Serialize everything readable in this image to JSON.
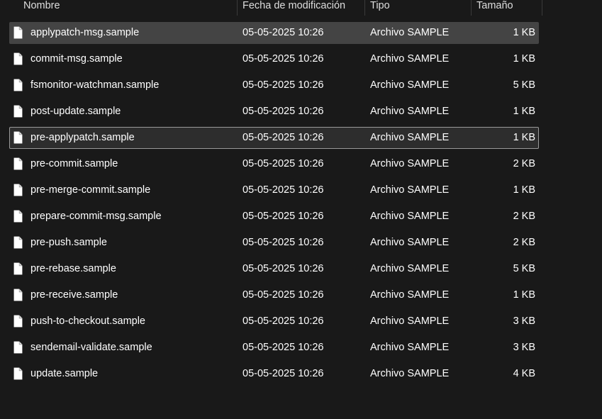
{
  "columns": {
    "name": "Nombre",
    "date": "Fecha de modificación",
    "type": "Tipo",
    "size": "Tamaño"
  },
  "files": [
    {
      "name": "applypatch-msg.sample",
      "date": "05-05-2025 10:26",
      "type": "Archivo SAMPLE",
      "size": "1 KB",
      "state": "selected"
    },
    {
      "name": "commit-msg.sample",
      "date": "05-05-2025 10:26",
      "type": "Archivo SAMPLE",
      "size": "1 KB",
      "state": ""
    },
    {
      "name": "fsmonitor-watchman.sample",
      "date": "05-05-2025 10:26",
      "type": "Archivo SAMPLE",
      "size": "5 KB",
      "state": ""
    },
    {
      "name": "post-update.sample",
      "date": "05-05-2025 10:26",
      "type": "Archivo SAMPLE",
      "size": "1 KB",
      "state": ""
    },
    {
      "name": "pre-applypatch.sample",
      "date": "05-05-2025 10:26",
      "type": "Archivo SAMPLE",
      "size": "1 KB",
      "state": "focused"
    },
    {
      "name": "pre-commit.sample",
      "date": "05-05-2025 10:26",
      "type": "Archivo SAMPLE",
      "size": "2 KB",
      "state": ""
    },
    {
      "name": "pre-merge-commit.sample",
      "date": "05-05-2025 10:26",
      "type": "Archivo SAMPLE",
      "size": "1 KB",
      "state": ""
    },
    {
      "name": "prepare-commit-msg.sample",
      "date": "05-05-2025 10:26",
      "type": "Archivo SAMPLE",
      "size": "2 KB",
      "state": ""
    },
    {
      "name": "pre-push.sample",
      "date": "05-05-2025 10:26",
      "type": "Archivo SAMPLE",
      "size": "2 KB",
      "state": ""
    },
    {
      "name": "pre-rebase.sample",
      "date": "05-05-2025 10:26",
      "type": "Archivo SAMPLE",
      "size": "5 KB",
      "state": ""
    },
    {
      "name": "pre-receive.sample",
      "date": "05-05-2025 10:26",
      "type": "Archivo SAMPLE",
      "size": "1 KB",
      "state": ""
    },
    {
      "name": "push-to-checkout.sample",
      "date": "05-05-2025 10:26",
      "type": "Archivo SAMPLE",
      "size": "3 KB",
      "state": ""
    },
    {
      "name": "sendemail-validate.sample",
      "date": "05-05-2025 10:26",
      "type": "Archivo SAMPLE",
      "size": "3 KB",
      "state": ""
    },
    {
      "name": "update.sample",
      "date": "05-05-2025 10:26",
      "type": "Archivo SAMPLE",
      "size": "4 KB",
      "state": ""
    }
  ],
  "icons": {
    "file": "file-icon"
  },
  "colors": {
    "background": "#191919",
    "selected_row": "#444444",
    "focused_row": "#2d2d2d",
    "focus_border": "#9a9a9a",
    "text": "#ffffff"
  }
}
